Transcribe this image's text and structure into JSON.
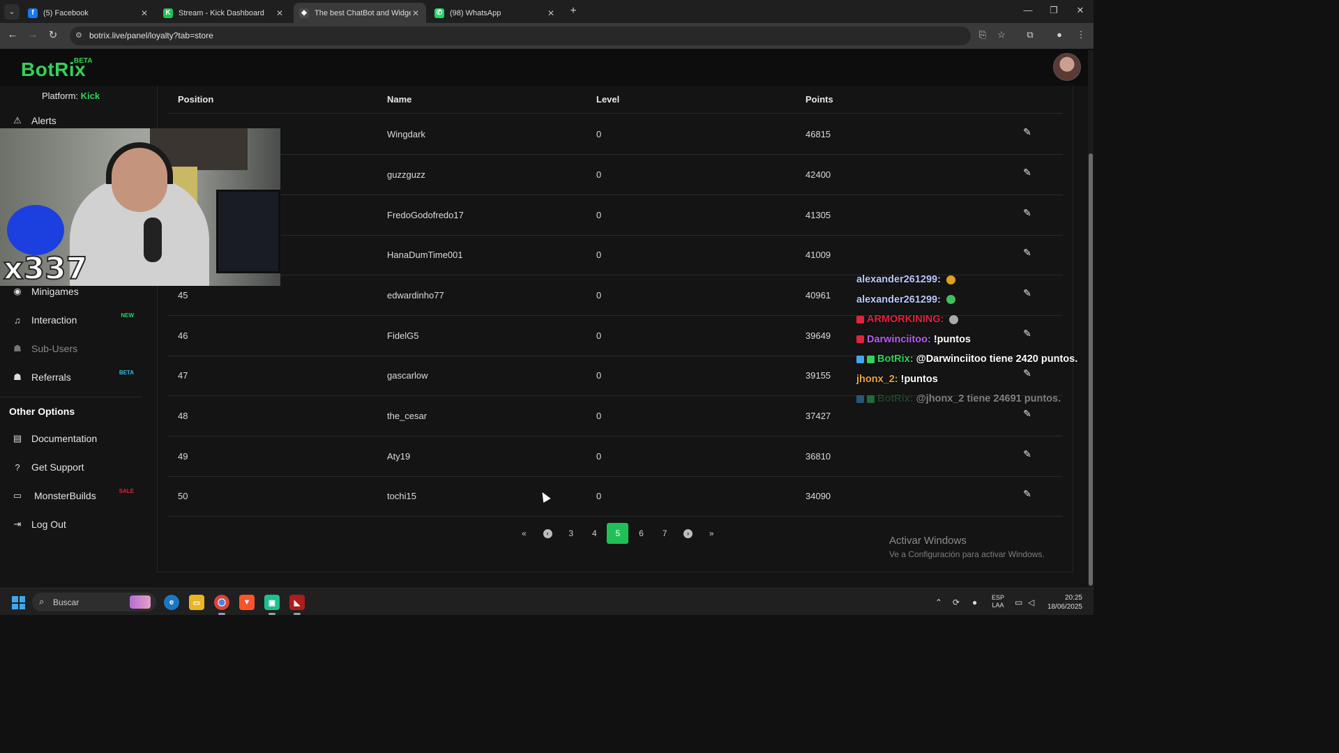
{
  "browser": {
    "tabs": [
      {
        "title": "(5) Facebook",
        "icon": "facebook-icon",
        "color": "#1877f2",
        "glyph": "f"
      },
      {
        "title": "Stream - Kick Dashboard",
        "icon": "kick-icon",
        "color": "#21c057",
        "glyph": "K"
      },
      {
        "title": "The best ChatBot and Widgets",
        "icon": "botrix-icon",
        "color": "#4a4a4a",
        "glyph": "◆"
      },
      {
        "title": "(98) WhatsApp",
        "icon": "whatsapp-icon",
        "color": "#25d366",
        "glyph": "✆"
      }
    ],
    "url": "botrix.live/panel/loyalty?tab=store"
  },
  "app": {
    "logo": "BotRix",
    "logo_badge": "BETA",
    "platform_label": "Platform:",
    "platform_value": "Kick"
  },
  "sidebar": {
    "items": [
      {
        "label": "Alerts",
        "icon": "alert-triangle-icon",
        "glyph": "⚠",
        "tag": ""
      },
      {
        "label": "Minigames",
        "icon": "gamepad-icon",
        "glyph": "🎮",
        "tag": ""
      },
      {
        "label": "Interaction",
        "icon": "music-note-icon",
        "glyph": "♫",
        "tag": "NEW"
      },
      {
        "label": "Sub-Users",
        "icon": "users-icon",
        "glyph": "👥",
        "tag": ""
      },
      {
        "label": "Referrals",
        "icon": "user-group-icon",
        "glyph": "👥",
        "tag": "BETA"
      }
    ],
    "other_options_title": "Other Options",
    "other_items": [
      {
        "label": "Documentation",
        "icon": "book-icon",
        "glyph": "▤",
        "tag": ""
      },
      {
        "label": "Get Support",
        "icon": "question-icon",
        "glyph": "?",
        "tag": ""
      },
      {
        "label": "MonsterBuilds",
        "icon": "laptop-icon",
        "glyph": "▭",
        "tag": "SALE"
      },
      {
        "label": "Log Out",
        "icon": "logout-icon",
        "glyph": "⇥",
        "tag": ""
      }
    ]
  },
  "table": {
    "headers": {
      "position": "Position",
      "name": "Name",
      "level": "Level",
      "points": "Points"
    },
    "rows": [
      {
        "position": "",
        "name": "Wingdark",
        "level": "0",
        "points": "46815"
      },
      {
        "position": "",
        "name": "guzzguzz",
        "level": "0",
        "points": "42400"
      },
      {
        "position": "",
        "name": "FredoGodofredo17",
        "level": "0",
        "points": "41305"
      },
      {
        "position": "",
        "name": "HanaDumTime001",
        "level": "0",
        "points": "41009"
      },
      {
        "position": "45",
        "name": "edwardinho77",
        "level": "0",
        "points": "40961"
      },
      {
        "position": "46",
        "name": "FidelG5",
        "level": "0",
        "points": "39649"
      },
      {
        "position": "47",
        "name": "gascarlow",
        "level": "0",
        "points": "39155"
      },
      {
        "position": "48",
        "name": "the_cesar",
        "level": "0",
        "points": "37427"
      },
      {
        "position": "49",
        "name": "Aty19",
        "level": "0",
        "points": "36810"
      },
      {
        "position": "50",
        "name": "tochi15",
        "level": "0",
        "points": "34090"
      }
    ]
  },
  "pagination": {
    "pages": [
      "3",
      "4",
      "5",
      "6",
      "7"
    ],
    "current": "5",
    "first": "«",
    "prev": "‹",
    "next": "›",
    "last": "»"
  },
  "chat": [
    {
      "user": "alexander261299:",
      "text": "",
      "color": "#b9c8ff",
      "emote": "#e0a020",
      "badge": ""
    },
    {
      "user": "alexander261299:",
      "text": "",
      "color": "#b9c8ff",
      "emote": "#3fbf5a",
      "badge": ""
    },
    {
      "user": "ARMORKINING:",
      "text": "",
      "color": "#e0243c",
      "emote": "#aaaaaa",
      "badge": "#e0243c"
    },
    {
      "user": "Darwinciitoo:",
      "text": "!puntos",
      "color": "#b45cf0",
      "emote": "",
      "badge": "#e0243c"
    },
    {
      "user": "BotRix:",
      "text": "@Darwinciitoo tiene 2420 puntos.",
      "color": "#35d15a",
      "emote": "",
      "badge": "#3fa7f0"
    },
    {
      "user": "jhonx_2:",
      "text": "!puntos",
      "color": "#e8a53a",
      "emote": "",
      "badge": ""
    },
    {
      "user": "BotRix:",
      "text": "@jhonx_2 tiene 24691 puntos.",
      "color": "#2f7a45",
      "emote": "",
      "badge": "#3fa7f0"
    }
  ],
  "overlay": {
    "counter": "x337"
  },
  "watermark": {
    "title": "Activar Windows",
    "subtitle": "Ve a Configuración para activar Windows."
  },
  "taskbar": {
    "search_label": "Buscar",
    "lang_top": "ESP",
    "lang_bottom": "LAA",
    "time": "20:25",
    "date": "18/06/2025"
  }
}
